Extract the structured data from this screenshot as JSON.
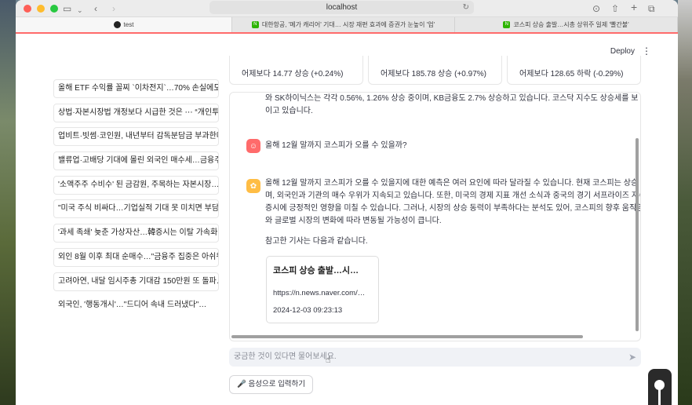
{
  "browser": {
    "address": "localhost",
    "tabs": [
      {
        "label": "test",
        "active": true
      },
      {
        "label": "대한항공, '메가 캐리어' 기대… 시장 재편 효과에 증권가 눈높이 '업'",
        "active": false
      },
      {
        "label": "코스피 상승 출발…시총 상위주 일제 '빨간불'",
        "active": false
      }
    ],
    "favicon_badge": "N"
  },
  "app": {
    "deploy_label": "Deploy",
    "menu_glyph": "⋮"
  },
  "news_list": [
    "올해 ETF 수익률 꼴찌 `이차전지`…70% 손실에도 …",
    "상법·자본시장법 개정보다 시급한 것은 ⋯ “개인투자…",
    "업비트·빗썸·코인원, 내년부터 감독분담금 부과한다…",
    "밸류업·고배당 기대에 몰린 외국인 매수세…금융주 '반…",
    "'소액주주 수비수' 된 금감원, 주목하는 자본시장…재거…",
    "\"미국 주식 비싸다…기업실적 기대 못 미치면 부담 확대…",
    "'과세 족쇄' 늦춘 가상자산…韓증시는 이탈 가속화…",
    "외인 8월 이후 최대 순매수…\"금융주 집중은 아쉬워\"",
    "고려아연, 내달 임시주총 기대감 150만원 또 돌파…경…",
    "외국인, '행동개시'…\"드디어 속내 드러냈다\"…"
  ],
  "metrics": [
    "어제보다 14.77 상승 (+0.24%)",
    "어제보다 185.78 상승 (+0.97%)",
    "어제보다 128.65 하락 (-0.29%)"
  ],
  "chat": {
    "prev_tail": [
      "와 SK하이닉스는 각각 0.56%, 1.26% 상승 중이며, KB금융도 2.7% 상승하고 있습니다. 코스닥 지수도 상승세를 보",
      "이고 있습니다."
    ],
    "user_question": "올해 12월 말까지 코스피가 오를 수 있을까?",
    "answer_lines": [
      "올해 12월 말까지 코스피가 오를 수 있을지에 대한 예측은 여러 요인에 따라 달라질 수 있습니다. 현재 코스피는 상승 출",
      "며, 외국인과 기관의 매수 우위가 지속되고 있습니다. 또한, 미국의 경제 지표 개선 소식과 중국의 경기 서프라이즈 지수",
      "증시에 긍정적인 영향을 미칠 수 있습니다. 그러나, 시장의 상승 동력이 부족하다는 분석도 있어, 코스피의 향후 움직임은",
      "와 글로벌 시장의 변화에 따라 변동될 가능성이 큽니다."
    ],
    "reference_intro": "참고한 기사는 다음과 같습니다.",
    "article_card": {
      "title": "코스피 상승 출발…시…",
      "url": "https://n.news.naver.com/…",
      "date": "2024-12-03 09:23:13"
    }
  },
  "input": {
    "placeholder": "궁금한 것이 있다면 물어보세요."
  },
  "voice_button": "🎤 음성으로 입력하기",
  "colors": {
    "accent": "#ff6b6b",
    "bot_avatar": "#ffbd45",
    "naver_green": "#2db400"
  },
  "icons": {
    "user_avatar": "user-face-icon",
    "bot_avatar": "bot-icon",
    "send": "send-icon"
  }
}
